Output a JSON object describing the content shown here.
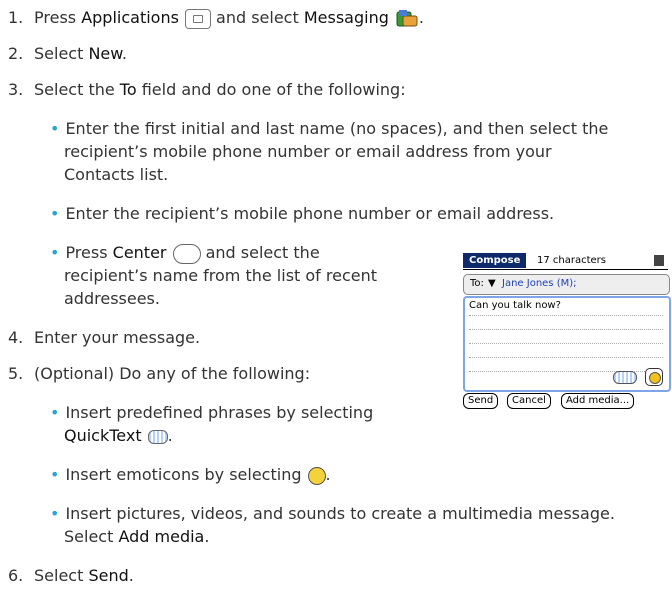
{
  "steps": [
    {
      "num": "1.",
      "pre": "Press ",
      "b1": "Applications",
      "mid": " and select ",
      "b2": "Messaging",
      "post": "."
    },
    {
      "num": "2.",
      "pre": "Select ",
      "b1": "New",
      "post": "."
    },
    {
      "num": "3.",
      "pre": "Select the ",
      "b1": "To",
      "post": " field and do one of the following:"
    },
    {
      "num": "4.",
      "text": "Enter your message."
    },
    {
      "num": "5.",
      "text": "(Optional)  Do any of the following:"
    },
    {
      "num": "6.",
      "pre": "Select ",
      "b1": "Send",
      "post": "."
    }
  ],
  "step3_bullets": {
    "b1_line1": "Enter the first initial and last name (no spaces), and then select the",
    "b1_line2": "recipient’s mobile phone number or email address from your",
    "b1_line3": "Contacts list.",
    "b2": "Enter the recipient’s mobile phone number or email address.",
    "b3_pre": "Press ",
    "b3_bold": "Center",
    "b3_post": " and select the",
    "b3_line2": "recipient’s name from the list of recent",
    "b3_line3": "addressees."
  },
  "step5_bullets": {
    "b1_line1": "Insert predefined phrases by selecting",
    "b1_bold": "QuickText",
    "b2_pre": "Insert emoticons by selecting",
    "b2_post": ".",
    "b3_line1": "Insert pictures, videos, and sounds to create a multimedia message.",
    "b3_pre": "Select ",
    "b3_bold": "Add media",
    "b3_post": "."
  },
  "phone": {
    "title": "Compose",
    "char_count": "17 characters",
    "to_label": "To:",
    "to_arrow": "▼",
    "recipient": "Jane Jones (M);",
    "message": "Can you talk now?",
    "buttons": [
      "Send",
      "Cancel",
      "Add media..."
    ]
  },
  "colors": {
    "bullet": "#2aa3d9",
    "title_bar": "#0f2a6b",
    "border_accent": "#7ca6e6"
  }
}
